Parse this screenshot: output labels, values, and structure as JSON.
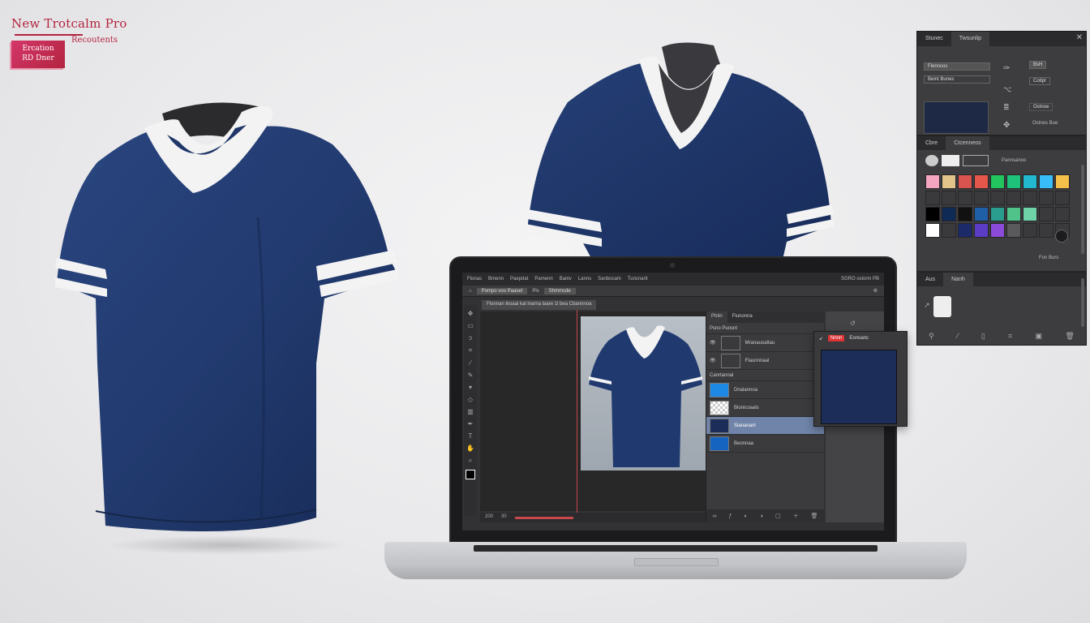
{
  "brand": {
    "title": "New Trotcalm Pro",
    "badge_line1": "Ercation",
    "badge_line2": "RD Dner",
    "subtitle": "Recoutents"
  },
  "colors": {
    "shirt_navy": "#1f3769",
    "shirt_trim": "#f3f3f3",
    "brand_red": "#b3243f",
    "panel_dark": "#3d3d3f",
    "selected_swatch": "#1c2d5a"
  },
  "app": {
    "menubar": [
      "Flonas",
      "Bmenn",
      "Paepdat",
      "Pamenn",
      "Baniv",
      "Lanns",
      "Sanbocam",
      "Tuncnarit"
    ],
    "title": "SGRO oslorm PB",
    "options_field1": "Pompo voo Paaset",
    "options_field2": "Pls",
    "options_field3": "Shmmcde",
    "document_tab": "Flonnan tkoaai kal lnarna laare 1l bea Cbannnoa",
    "tool_icons": [
      "move-icon",
      "marquee-icon",
      "lasso-icon",
      "crop-icon",
      "eyedropper-icon",
      "brush-icon",
      "stamp-icon",
      "eraser-icon",
      "gradient-icon",
      "pen-icon",
      "type-icon",
      "hand-icon",
      "zoom-icon"
    ],
    "status_zoom": "200",
    "status_info": "30",
    "layers": {
      "tabs": [
        "Ptnln",
        "Flunonna"
      ],
      "header": "Psno Puosnt",
      "rows": [
        {
          "name": "Mranauoaltau",
          "thumb": "#3a3a3c"
        },
        {
          "name": "Flaunnnaal",
          "thumb": "#3a3a3c"
        },
        {
          "name": "Canrtannal",
          "thumb": "#2f2f31"
        },
        {
          "name": "Dnalannoa",
          "thumb": "#1e88e5"
        },
        {
          "name": "Bionicoaals",
          "thumb": "#ffffff"
        },
        {
          "name": "Sianananl",
          "thumb": "#1c2d5a"
        },
        {
          "name": "Beonnaa",
          "thumb": "#1565c0"
        }
      ],
      "selected_index": 5,
      "footer_icons": [
        "link-icon",
        "fx-icon",
        "mask-icon",
        "adjustment-icon",
        "folder-icon",
        "new-layer-icon",
        "trash-icon"
      ]
    }
  },
  "swatch_popup": {
    "label1": "Nnnn",
    "label2": "Eonoanc"
  },
  "right_panel": {
    "tabs": [
      "Stunec",
      "Twsunlip"
    ],
    "top_buttons": [
      "Flenncos",
      "Beint Bunes"
    ],
    "top_right_labels": [
      "BsH",
      "Cotlpt",
      "Ostnoe",
      "Ostnes Bue"
    ],
    "section2_tabs": [
      "Cbre",
      "Ctcenneos"
    ],
    "section2_label": "Pannsanoo",
    "swatches": [
      "#f4a6c0",
      "#e1c48a",
      "#d9534f",
      "#e4574a",
      "#22c55e",
      "#1ec27a",
      "#22b8cf",
      "#38bdf8",
      "#f5c04a",
      "#3a3a3c",
      "#3a3a3c",
      "#3a3a3c",
      "#3a3a3c",
      "#3a3a3c",
      "#3a3a3c",
      "#3a3a3c",
      "#3a3a3c",
      "#3a3a3c",
      "#000000",
      "#0f2a55",
      "#111111",
      "#1f5fa8",
      "#2a9d8f",
      "#4fc38a",
      "#6fd3a8",
      "#3a3a3c",
      "#3a3a3c",
      "#ffffff",
      "#3a3a3c",
      "#1c2a6a",
      "#5b3cc4",
      "#8b4ad8",
      "#5a5a5c",
      "#3a3a3c",
      "#3a3a3c",
      "#3a3a3c"
    ],
    "side_label": "Fon Burs",
    "section3_tabs": [
      "Aus",
      "Nanh"
    ],
    "footer_icons": [
      "adjust-icon",
      "brush-icon",
      "page-icon",
      "crop-icon",
      "rect-icon",
      "trash-icon"
    ]
  }
}
